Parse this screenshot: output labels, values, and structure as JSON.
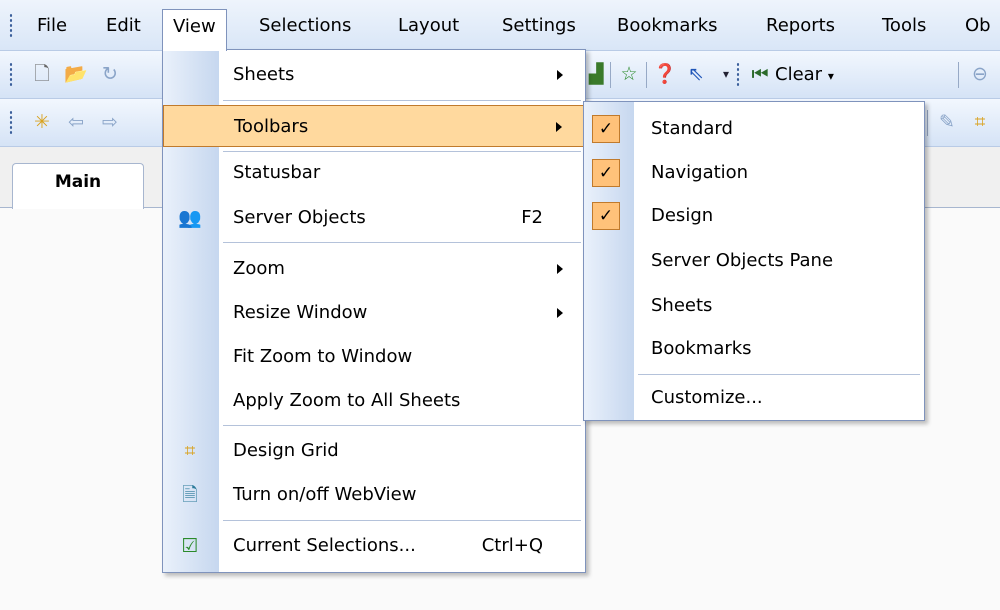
{
  "menubar": {
    "items": [
      "File",
      "Edit",
      "View",
      "Selections",
      "Layout",
      "Settings",
      "Bookmarks",
      "Reports",
      "Tools",
      "Ob"
    ]
  },
  "toolbar": {
    "clear_label": "Clear"
  },
  "tabs": [
    {
      "label": "Main",
      "active": true
    }
  ],
  "view_menu": {
    "items": [
      {
        "label": "Sheets",
        "submenu": true
      },
      {
        "label": "Toolbars",
        "submenu": true,
        "highlighted": true
      },
      {
        "label": "Statusbar"
      },
      {
        "label": "Server Objects",
        "shortcut": "F2",
        "icon": "server-objects-icon"
      },
      {
        "label": "Zoom",
        "submenu": true
      },
      {
        "label": "Resize Window",
        "submenu": true
      },
      {
        "label": "Fit Zoom to Window"
      },
      {
        "label": "Apply Zoom to All Sheets"
      },
      {
        "label": "Design Grid",
        "icon": "design-grid-icon"
      },
      {
        "label": "Turn on/off WebView",
        "icon": "webview-icon"
      },
      {
        "label": "Current Selections...",
        "shortcut": "Ctrl+Q",
        "icon": "current-selections-icon"
      }
    ]
  },
  "toolbars_submenu": {
    "items": [
      {
        "label": "Standard",
        "checked": true
      },
      {
        "label": "Navigation",
        "checked": true
      },
      {
        "label": "Design",
        "checked": true
      },
      {
        "label": "Server Objects Pane",
        "checked": false
      },
      {
        "label": "Sheets",
        "checked": false
      },
      {
        "label": "Bookmarks",
        "checked": false
      },
      {
        "label": "Customize...",
        "checked": false
      }
    ]
  },
  "colors": {
    "highlight": "#ffd99e",
    "check_bg": "#ffc27a",
    "menubar_bg": "#dbe7f8",
    "border": "#7f93bc"
  }
}
